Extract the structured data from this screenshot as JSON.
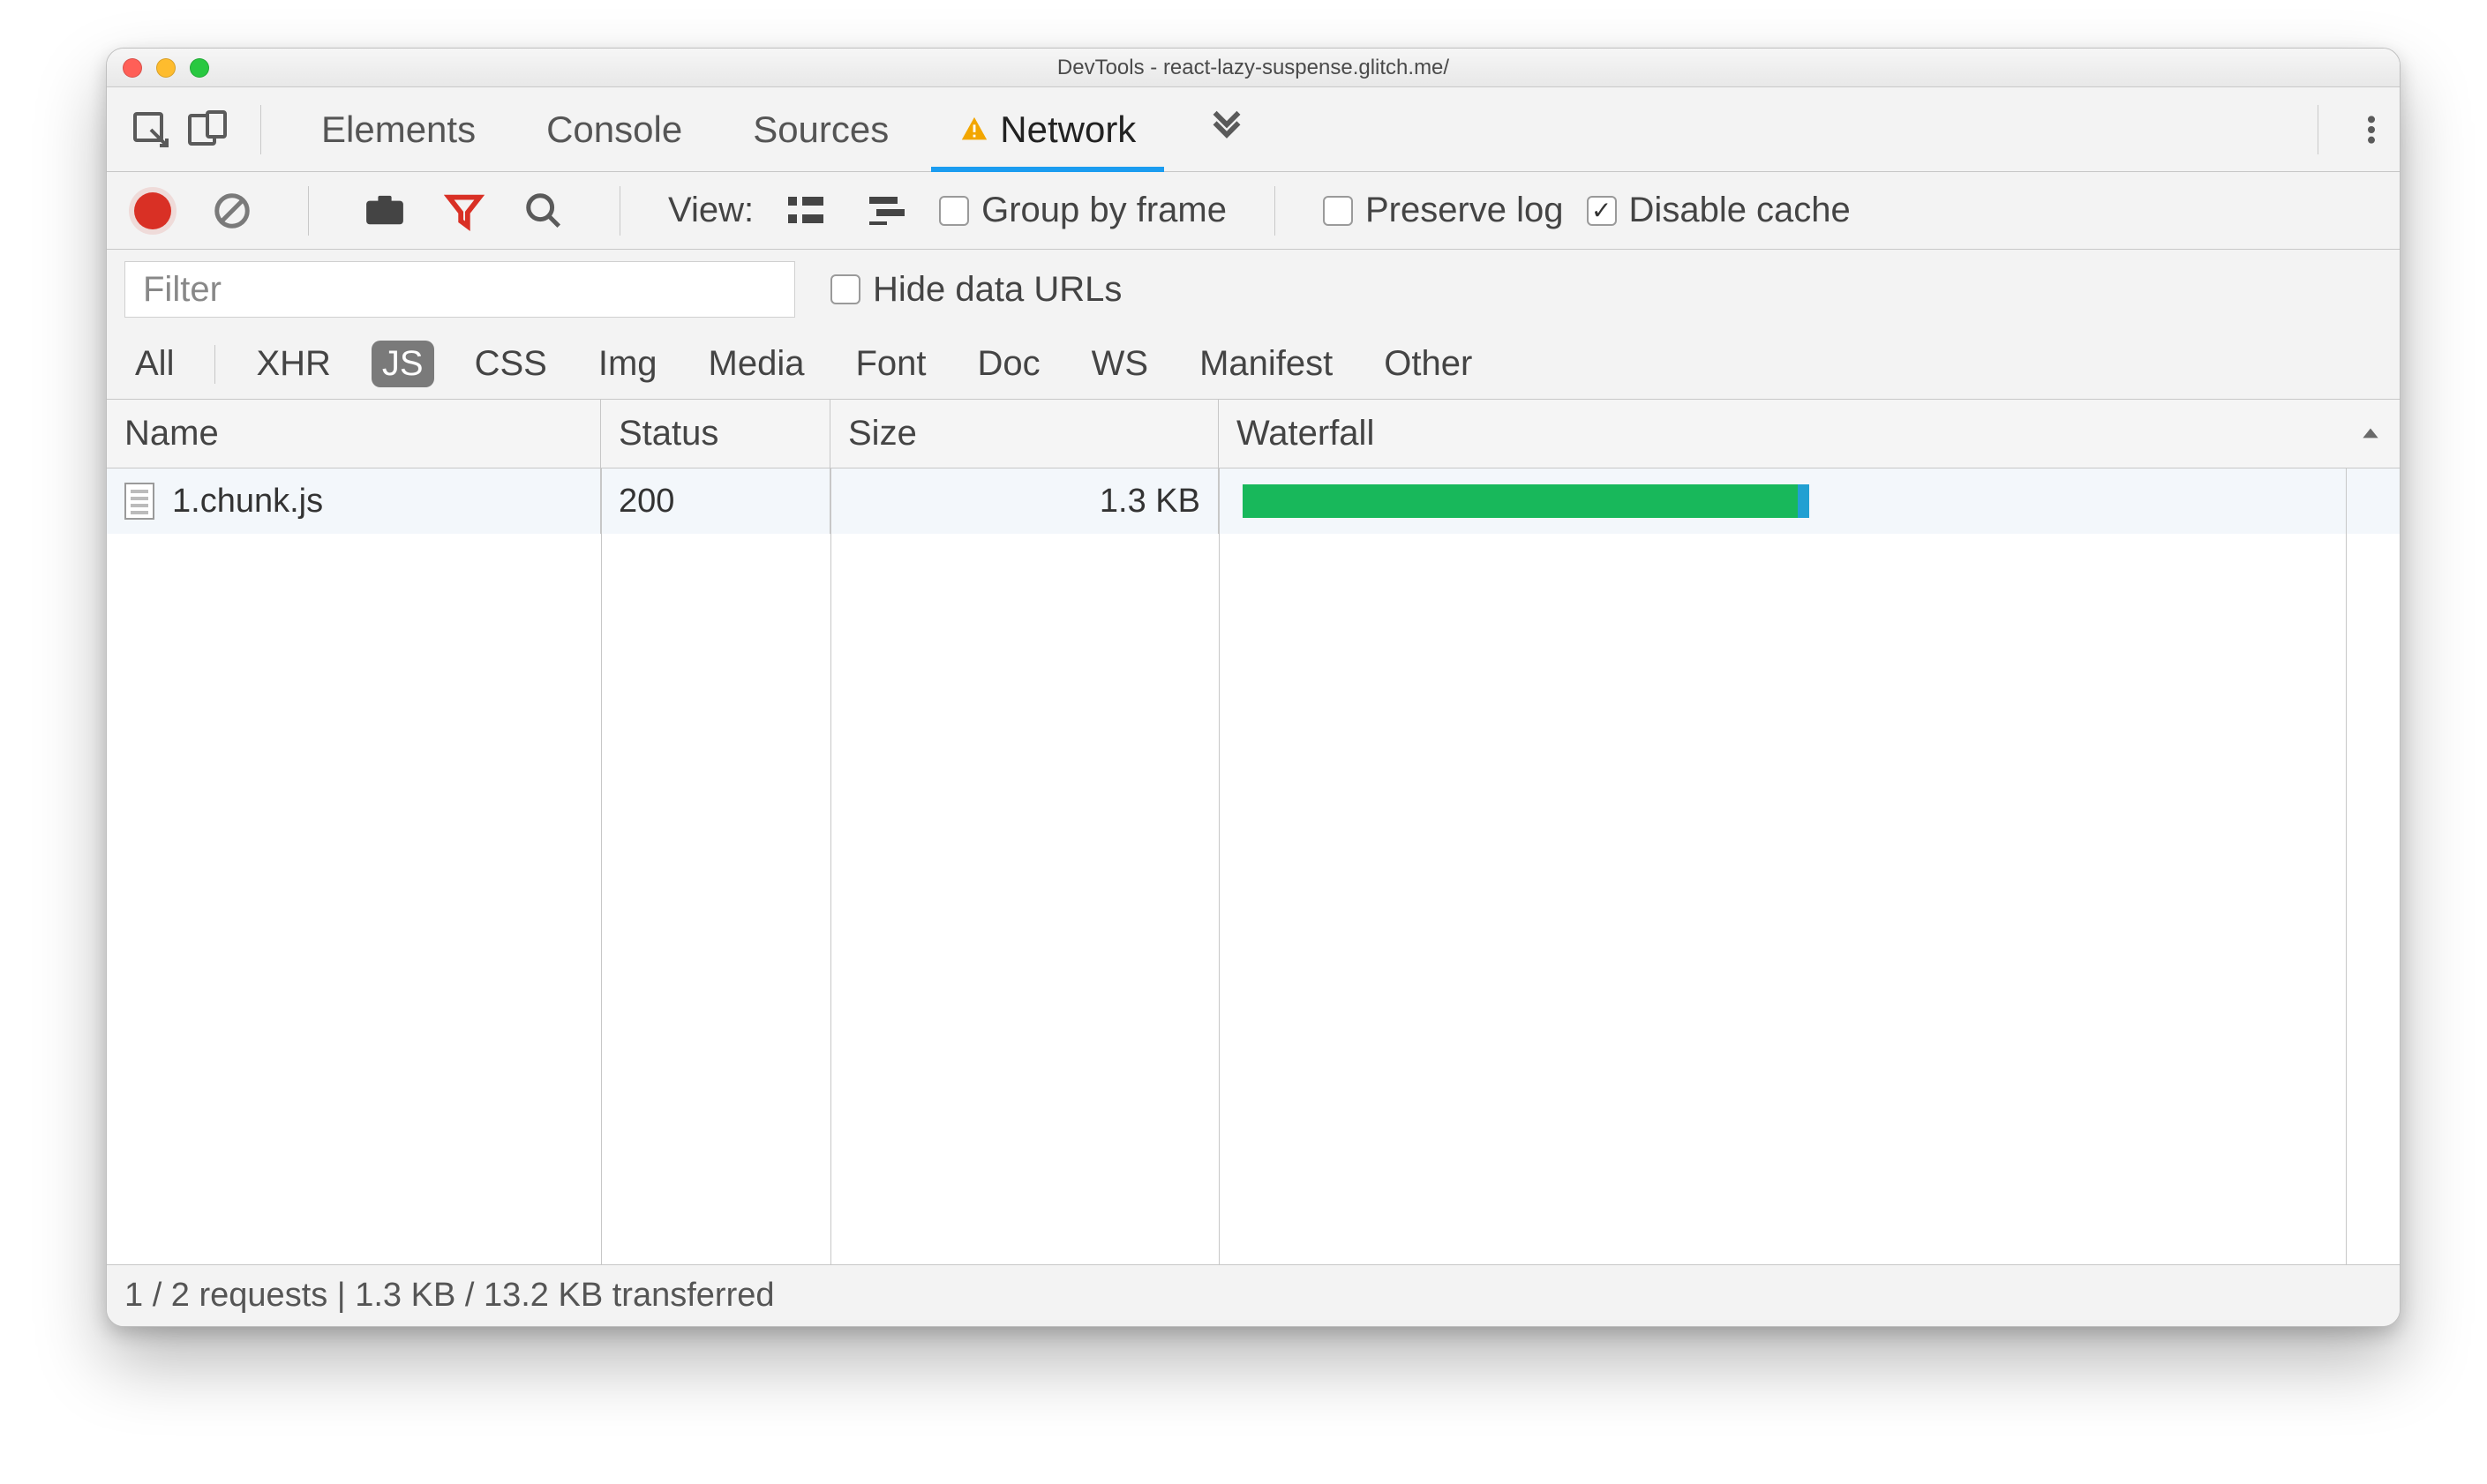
{
  "window": {
    "title": "DevTools - react-lazy-suspense.glitch.me/"
  },
  "tabs": {
    "items": [
      "Elements",
      "Console",
      "Sources",
      "Network"
    ],
    "active_index": 3,
    "has_warning_on_active": true
  },
  "toolbar": {
    "view_label": "View:",
    "group_by_frame_label": "Group by frame",
    "preserve_log_label": "Preserve log",
    "disable_cache_label": "Disable cache",
    "group_by_frame_checked": false,
    "preserve_log_checked": false,
    "disable_cache_checked": true
  },
  "filter": {
    "placeholder": "Filter",
    "value": "",
    "hide_data_urls_label": "Hide data URLs",
    "hide_data_urls_checked": false
  },
  "type_filters": {
    "items": [
      "All",
      "XHR",
      "JS",
      "CSS",
      "Img",
      "Media",
      "Font",
      "Doc",
      "WS",
      "Manifest",
      "Other"
    ],
    "active_index": 2
  },
  "table": {
    "columns": {
      "name": "Name",
      "status": "Status",
      "size": "Size",
      "waterfall": "Waterfall"
    },
    "rows": [
      {
        "name": "1.chunk.js",
        "status": "200",
        "size": "1.3 KB",
        "waterfall": {
          "start_pct": 2,
          "width_pct": 47,
          "tail_pct": 1
        }
      }
    ],
    "sort_column": "waterfall",
    "sort_direction": "asc"
  },
  "status_bar": {
    "text": "1 / 2 requests | 1.3 KB / 13.2 KB transferred"
  },
  "colors": {
    "accent": "#1a9cf0",
    "record": "#d93025",
    "funnel": "#d93025",
    "waterfall_bar": "#18b85b",
    "waterfall_tail": "#21a0d2"
  }
}
